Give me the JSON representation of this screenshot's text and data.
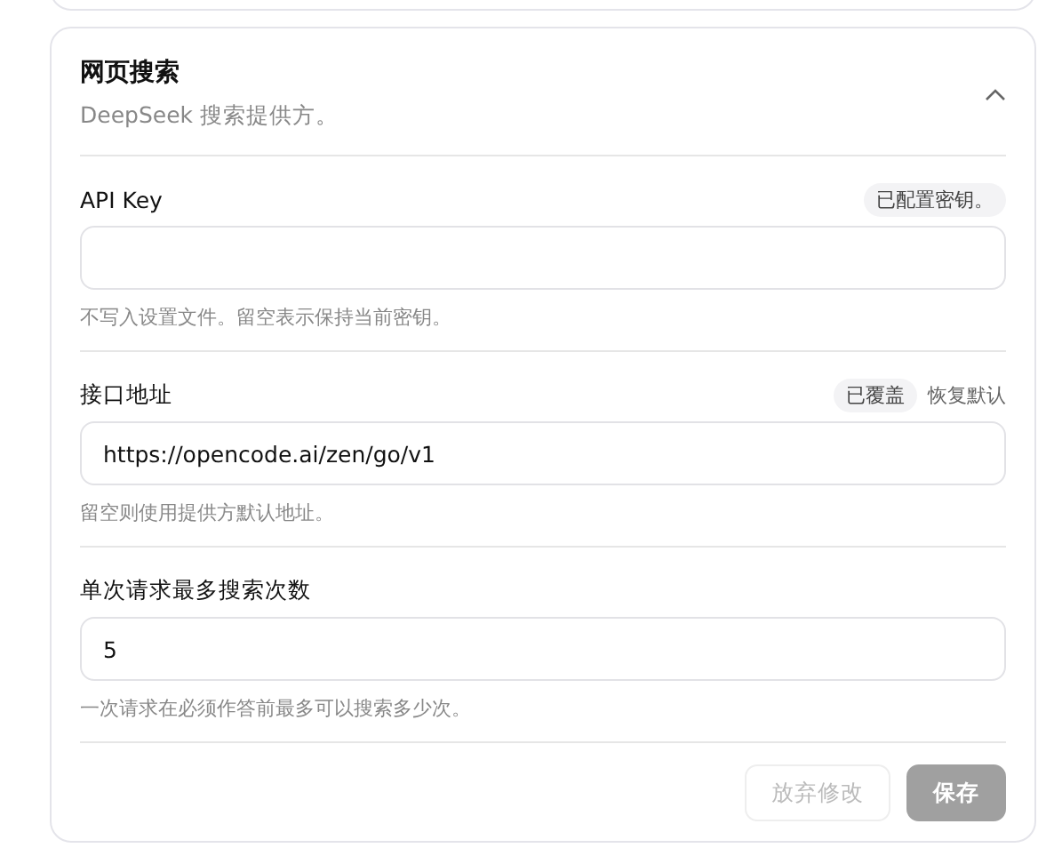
{
  "section": {
    "title": "网页搜索",
    "subtitle": "DeepSeek 搜索提供方。",
    "expanded": true
  },
  "fields": [
    {
      "label": "API Key",
      "badges": [
        "已配置密钥。"
      ],
      "hint": "不写入设置文件。留空表示保持当前密钥。"
    },
    {
      "label": "接口地址",
      "badges": [
        "已覆盖"
      ],
      "action": "恢复默认",
      "value": "https://opencode.ai/zen/go/v1",
      "hint": "留空则使用提供方默认地址。"
    },
    {
      "label": "单次请求最多搜索次数",
      "value": "5",
      "hint": "一次请求在必须作答前最多可以搜索多少次。"
    }
  ],
  "buttons": [
    {
      "label": "放弃修改",
      "kind": "secondary",
      "disabled": true
    },
    {
      "label": "保存",
      "kind": "primary",
      "disabled": true
    }
  ]
}
